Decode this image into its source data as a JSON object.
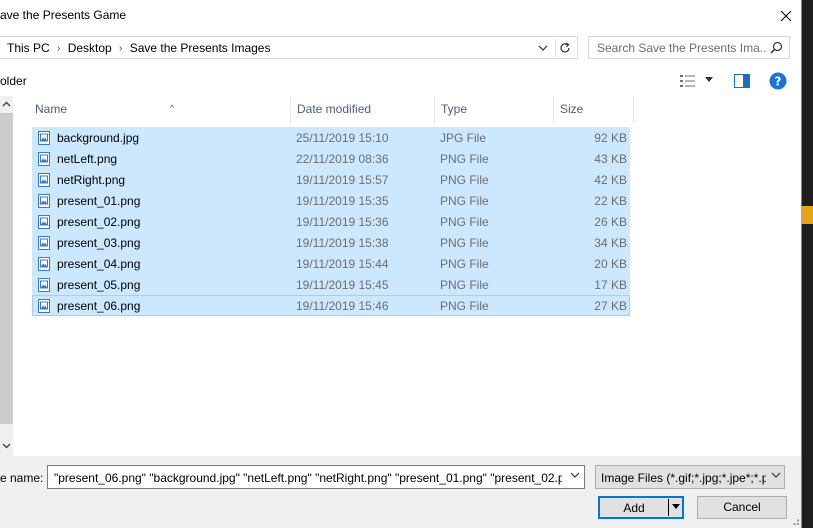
{
  "window": {
    "title": "ave the Presents Game"
  },
  "address": {
    "crumbs": [
      "This PC",
      "Desktop",
      "Save the Presents Images"
    ],
    "separator": "›"
  },
  "search": {
    "placeholder": "Search Save the Presents Ima..."
  },
  "toolbar": {
    "folder_label": "older"
  },
  "columns": {
    "name": "Name",
    "date": "Date modified",
    "type": "Type",
    "size": "Size"
  },
  "files": [
    {
      "name": "background.jpg",
      "date": "25/11/2019 15:10",
      "type": "JPG File",
      "size": "92 KB"
    },
    {
      "name": "netLeft.png",
      "date": "22/11/2019 08:36",
      "type": "PNG File",
      "size": "43 KB"
    },
    {
      "name": "netRight.png",
      "date": "19/11/2019 15:57",
      "type": "PNG File",
      "size": "42 KB"
    },
    {
      "name": "present_01.png",
      "date": "19/11/2019 15:35",
      "type": "PNG File",
      "size": "22 KB"
    },
    {
      "name": "present_02.png",
      "date": "19/11/2019 15:36",
      "type": "PNG File",
      "size": "26 KB"
    },
    {
      "name": "present_03.png",
      "date": "19/11/2019 15:38",
      "type": "PNG File",
      "size": "34 KB"
    },
    {
      "name": "present_04.png",
      "date": "19/11/2019 15:44",
      "type": "PNG File",
      "size": "20 KB"
    },
    {
      "name": "present_05.png",
      "date": "19/11/2019 15:45",
      "type": "PNG File",
      "size": "17 KB"
    },
    {
      "name": "present_06.png",
      "date": "19/11/2019 15:46",
      "type": "PNG File",
      "size": "27 KB"
    }
  ],
  "bottom": {
    "filename_label": "e name:",
    "filename_value": "\"present_06.png\" \"background.jpg\" \"netLeft.png\" \"netRight.png\" \"present_01.png\" \"present_02.pr",
    "filter_value": "Image Files (*.gif;*.jpg;*.jpe*;*.p",
    "add_label": "Add",
    "cancel_label": "Cancel"
  },
  "colors": {
    "selection": "#cce8ff",
    "selection_border": "#99d1ff",
    "accent": "#0078d7",
    "header_text": "#4c607a"
  },
  "icons": [
    "close-icon",
    "chevron-down-icon",
    "refresh-icon",
    "search-icon",
    "view-options-icon",
    "preview-pane-icon",
    "help-icon",
    "image-file-icon",
    "scroll-up-icon",
    "scroll-down-icon",
    "resize-grip-icon"
  ]
}
